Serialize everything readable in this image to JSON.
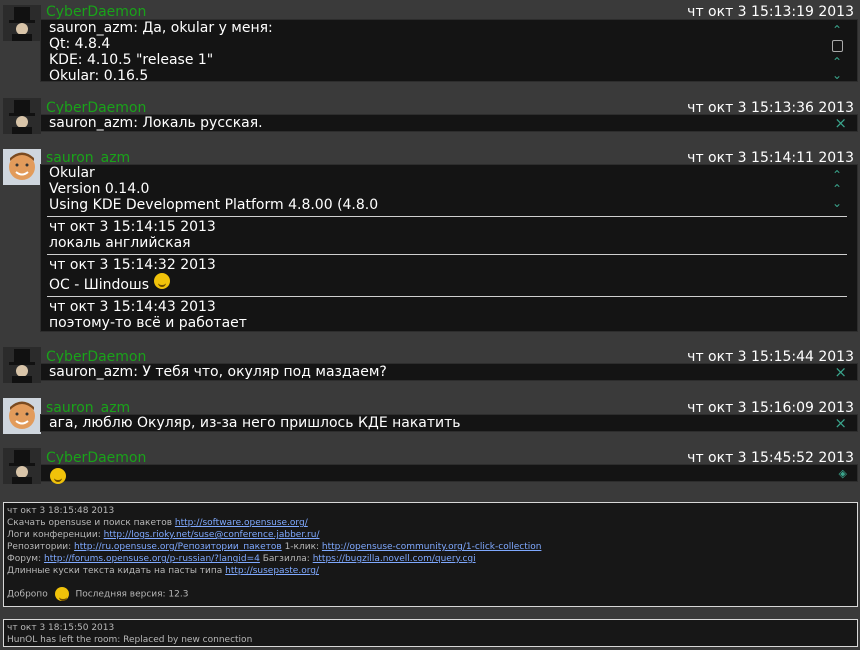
{
  "messages": [
    {
      "nick": "CyberDaemon",
      "time": "чт окт 3 15:13:19 2013",
      "lines": [
        "sauron_azm: Да, okular у меня:",
        "Qt: 4.8.4",
        "KDE: 4.10.5 \"release 1\"",
        "Okular: 0.16.5"
      ]
    },
    {
      "nick": "CyberDaemon",
      "time": "чт окт 3 15:13:36 2013",
      "lines": [
        "sauron_azm: Локаль русская."
      ]
    },
    {
      "nick": "sauron_azm",
      "time": "чт окт 3 15:14:11 2013",
      "lines": [
        "Okular",
        "Version 0.14.0",
        "Using KDE Development Platform 4.8.00 (4.8.0"
      ],
      "followups": [
        {
          "time": "чт окт 3 15:14:15 2013",
          "text": "локаль английская"
        },
        {
          "time": "чт окт 3 15:14:32 2013",
          "text": "ОС - Шindoшs"
        },
        {
          "time": "чт окт 3 15:14:43 2013",
          "text": "поэтому-то всё и работает"
        }
      ]
    },
    {
      "nick": "CyberDaemon",
      "time": "чт окт 3 15:15:44 2013",
      "lines": [
        "sauron_azm: У тебя что, окуляр под маздаем?"
      ]
    },
    {
      "nick": "sauron_azm",
      "time": "чт окт 3 15:16:09 2013",
      "lines": [
        "ага, люблю Окуляр, из-за него пришлось КДЕ накатить"
      ]
    },
    {
      "nick": "CyberDaemon",
      "time": "чт окт 3 15:45:52 2013",
      "lines": []
    }
  ],
  "topic": {
    "time": "чт окт 3 18:15:48 2013",
    "l1_text": "Скачать opensuse и поиск пакетов ",
    "l1_link": "http://software.opensuse.org/",
    "l2_text": "Логи конференции: ",
    "l2_link": "http://logs.rioky.net/suse@conference.jabber.ru/",
    "l3_text": "Репозитории: ",
    "l3_link": "http://ru.opensuse.org/Репозитории_пакетов",
    "l3_mid": " 1-клик: ",
    "l3_link2": "http://opensuse-community.org/1-click-collection",
    "l4_text": "Форум: ",
    "l4_link": "http://forums.opensuse.org/p-russian/?langid=4",
    "l4_mid": " Багзилла: ",
    "l4_link2": "https://bugzilla.novell.com/query.cgi",
    "l5_text": "Длинные куски текста кидать на пасты типа ",
    "l5_link": "http://susepaste.org/",
    "welcome": "Добропо",
    "version": "Последняя версия: 12.3"
  },
  "event": {
    "time": "чт окт 3 18:15:50 2013",
    "text": "HunOL has left the room: Replaced by new connection"
  },
  "icons": {
    "scroll_up": "scroll-up-icon",
    "scroll_down": "scroll-down-icon",
    "close": "close-icon",
    "avatar_bot": "tophat-avatar",
    "avatar_user": "face-avatar"
  }
}
